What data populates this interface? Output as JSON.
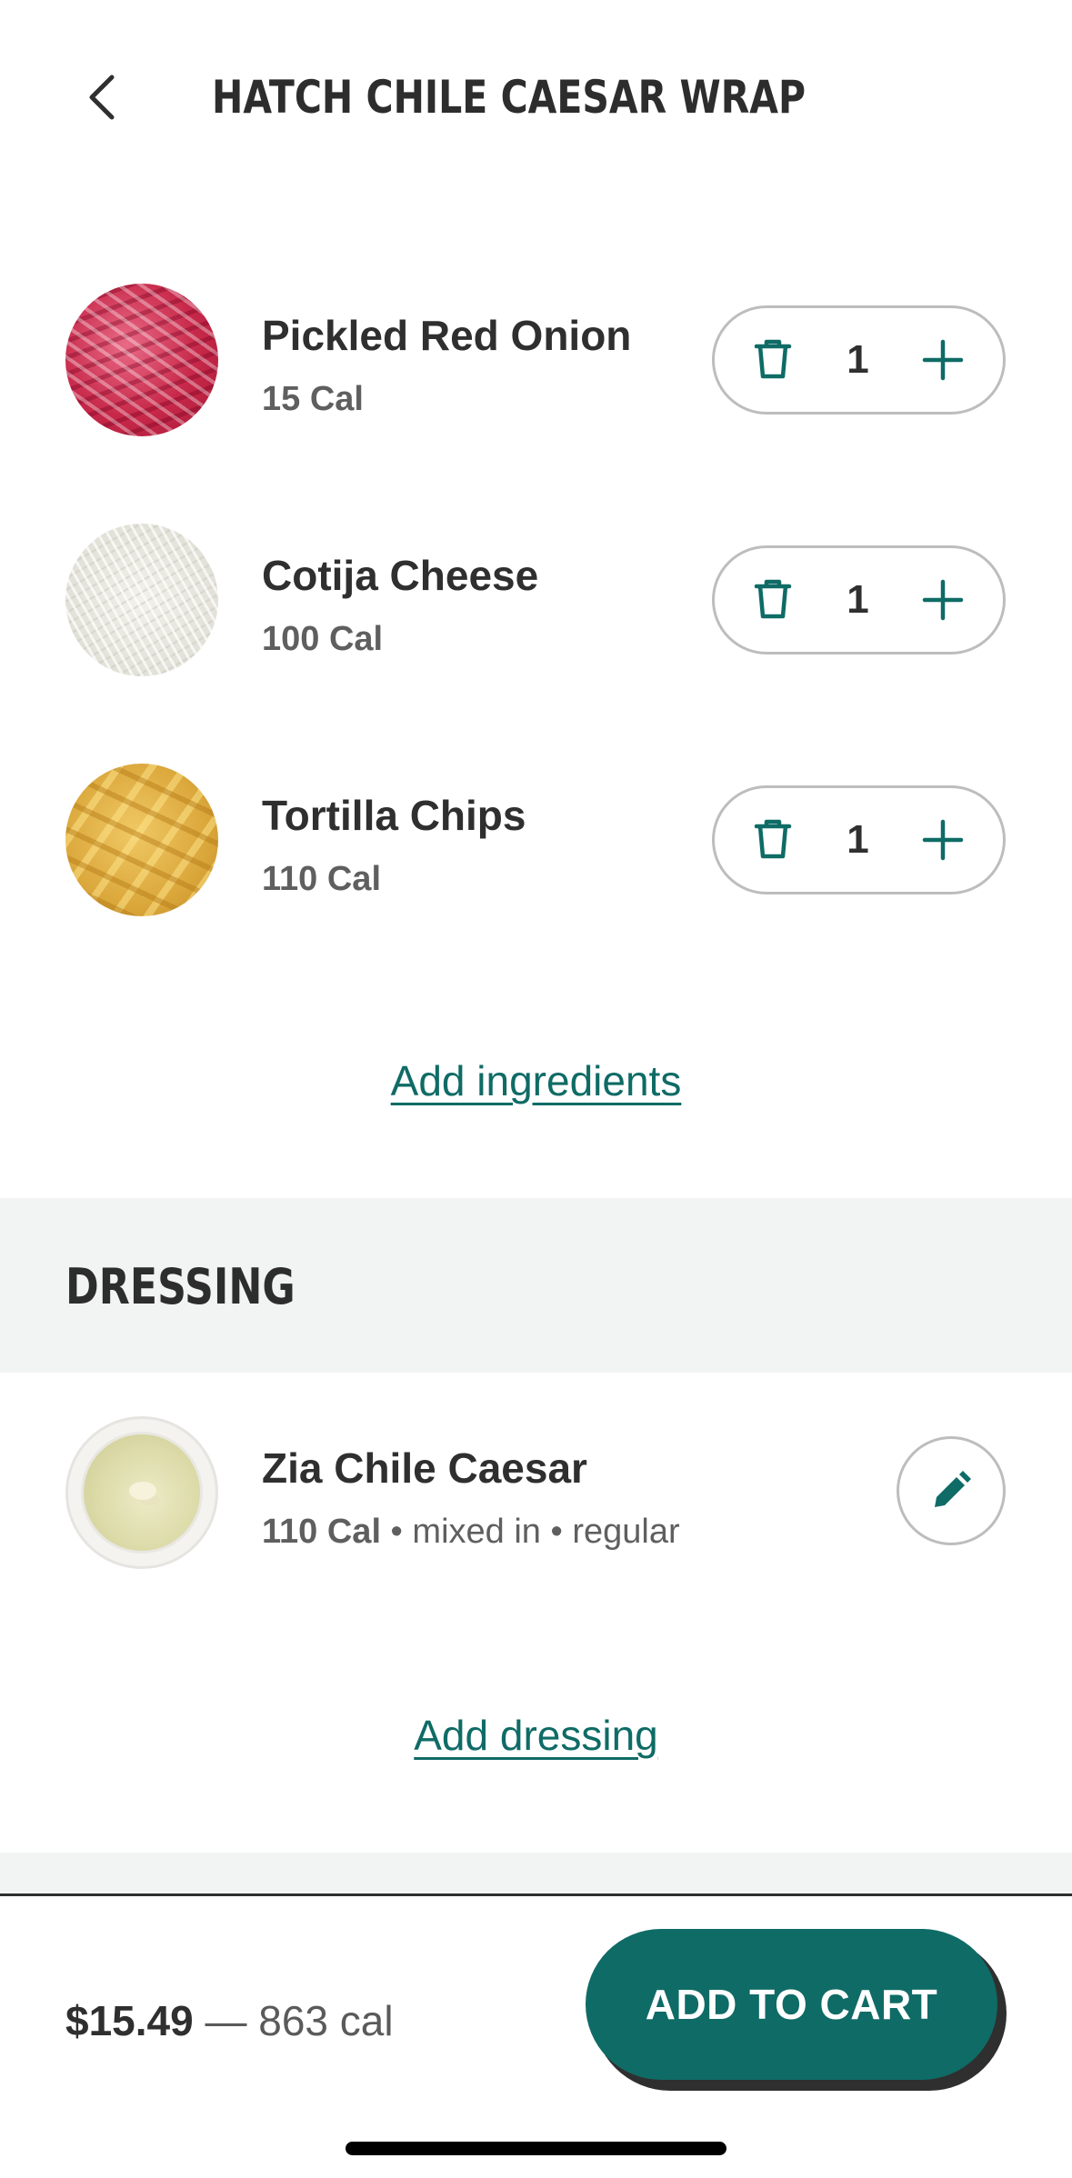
{
  "header": {
    "title": "HATCH CHILE CAESAR WRAP",
    "back_icon": "chevron-left-icon"
  },
  "ingredients": [
    {
      "name": "Pickled Red Onion",
      "calories": "15 Cal",
      "quantity": "1"
    },
    {
      "name": "Cotija Cheese",
      "calories": "100 Cal",
      "quantity": "1"
    },
    {
      "name": "Tortilla Chips",
      "calories": "110 Cal",
      "quantity": "1"
    }
  ],
  "add_ingredients_label": "Add ingredients",
  "dressing_section": {
    "title": "DRESSING",
    "item": {
      "name": "Zia Chile Caesar",
      "calories": "110 Cal",
      "details": " • mixed in • regular"
    },
    "add_label": "Add dressing"
  },
  "footer": {
    "price": "$15.49",
    "calories": " — 863 cal",
    "add_to_cart_label": "ADD TO CART"
  },
  "colors": {
    "accent": "#0f6b66",
    "section_band": "#f2f4f3",
    "text_primary": "#2f2f2f",
    "text_secondary": "#5f5f5f"
  }
}
